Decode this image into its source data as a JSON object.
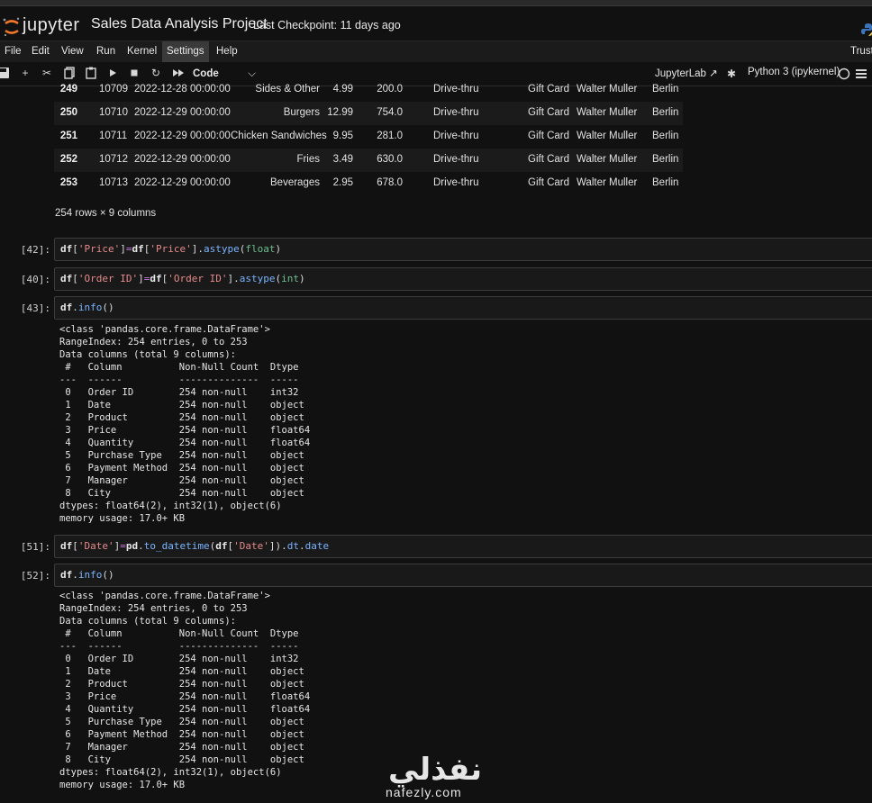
{
  "header": {
    "logo_text": "jupyter",
    "notebook_title": "Sales Data Analysis Project",
    "checkpoint": "Last Checkpoint: 11 days ago"
  },
  "menubar": {
    "items": [
      "File",
      "Edit",
      "View",
      "Run",
      "Kernel",
      "Settings",
      "Help"
    ],
    "active": "Settings",
    "trusted": "Trusted"
  },
  "toolbar": {
    "cell_type": "Code",
    "jupyterlab": "JupyterLab",
    "kernel": "Python 3 (ipykernel)",
    "icons": [
      "save-icon",
      "add-cell-icon",
      "cut-icon",
      "copy-icon",
      "paste-icon",
      "run-icon",
      "interrupt-icon",
      "restart-icon",
      "restart-run-all-icon",
      "external-link-icon",
      "settings-gear-icon",
      "kernel-status-icon",
      "menu-icon"
    ]
  },
  "dataframe": {
    "rows": [
      [
        "249",
        "10709",
        "2022-12-28 00:00:00",
        "Sides & Other",
        "4.99",
        "200.0",
        "Drive-thru",
        "Gift Card",
        "Walter Muller",
        "Berlin"
      ],
      [
        "250",
        "10710",
        "2022-12-29 00:00:00",
        "Burgers",
        "12.99",
        "754.0",
        "Drive-thru",
        "Gift Card",
        "Walter Muller",
        "Berlin"
      ],
      [
        "251",
        "10711",
        "2022-12-29 00:00:00",
        "Chicken Sandwiches",
        "9.95",
        "281.0",
        "Drive-thru",
        "Gift Card",
        "Walter Muller",
        "Berlin"
      ],
      [
        "252",
        "10712",
        "2022-12-29 00:00:00",
        "Fries",
        "3.49",
        "630.0",
        "Drive-thru",
        "Gift Card",
        "Walter Muller",
        "Berlin"
      ],
      [
        "253",
        "10713",
        "2022-12-29 00:00:00",
        "Beverages",
        "2.95",
        "678.0",
        "Drive-thru",
        "Gift Card",
        "Walter Muller",
        "Berlin"
      ]
    ],
    "shape_text": "254 rows × 9 columns"
  },
  "cells": [
    {
      "prompt": "[42]:",
      "code": "df['Price']=df['Price'].astype(float)"
    },
    {
      "prompt": "[40]:",
      "code": "df['Order ID']=df['Order ID'].astype(int)"
    },
    {
      "prompt": "[43]:",
      "code": "df.info()",
      "output": "<class 'pandas.core.frame.DataFrame'>\nRangeIndex: 254 entries, 0 to 253\nData columns (total 9 columns):\n #   Column          Non-Null Count  Dtype  \n---  ------          --------------  -----  \n 0   Order ID        254 non-null    int32  \n 1   Date            254 non-null    object \n 2   Product         254 non-null    object \n 3   Price           254 non-null    float64\n 4   Quantity        254 non-null    float64\n 5   Purchase Type   254 non-null    object \n 6   Payment Method  254 non-null    object \n 7   Manager         254 non-null    object \n 8   City            254 non-null    object \ndtypes: float64(2), int32(1), object(6)\nmemory usage: 17.0+ KB"
    },
    {
      "prompt": "[51]:",
      "code": "df['Date']=pd.to_datetime(df['Date']).dt.date"
    },
    {
      "prompt": "[52]:",
      "code": "df.info()",
      "output": "<class 'pandas.core.frame.DataFrame'>\nRangeIndex: 254 entries, 0 to 253\nData columns (total 9 columns):\n #   Column          Non-Null Count  Dtype  \n---  ------          --------------  -----  \n 0   Order ID        254 non-null    int32  \n 1   Date            254 non-null    object \n 2   Product         254 non-null    object \n 3   Price           254 non-null    float64\n 4   Quantity        254 non-null    float64\n 5   Purchase Type   254 non-null    object \n 6   Payment Method  254 non-null    object \n 7   Manager         254 non-null    object \n 8   City            254 non-null    object \ndtypes: float64(2), int32(1), object(6)\nmemory usage: 17.0+ KB"
    }
  ],
  "watermark": {
    "arabic": "نفذلي",
    "latin": "nafezly.com"
  },
  "colors": {
    "background": "#111111",
    "jupyter_orange": "#f37726",
    "string": "#e58a8a",
    "attribute": "#7ab4ff"
  }
}
